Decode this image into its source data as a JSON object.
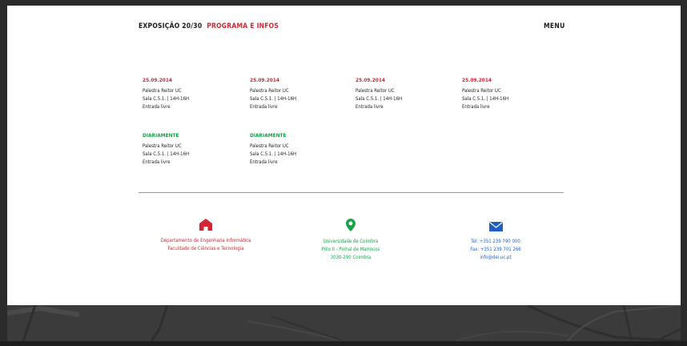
{
  "header": {
    "title": "EXPOSIÇÃO 20/30",
    "subtitle": "PROGRAMA E INFOS",
    "menu_label": "MENU"
  },
  "events": [
    {
      "date": "25.09.2014",
      "line1": "Palestra Reitor UC",
      "line2": "Sala C.5.1. | 14H-16H",
      "line3": "Entrada livre"
    },
    {
      "date": "25.09.2014",
      "line1": "Palestra Reitor UC",
      "line2": "Sala C.5.1. | 14H-16H",
      "line3": "Entrada livre"
    },
    {
      "date": "25.09.2014",
      "line1": "Palestra Reitor UC",
      "line2": "Sala C.5.1. | 14H-16H",
      "line3": "Entrada livre"
    },
    {
      "date": "25.09.2014",
      "line1": "Palestra Reitor UC",
      "line2": "Sala C.5.1. | 14H-16H",
      "line3": "Entrada livre"
    },
    {
      "date": "DIARIAMENTE",
      "line1": "Palestra Reitor UC",
      "line2": "Sala C.5.1. | 14H-16H",
      "line3": "Entrada livre"
    },
    {
      "date": "DIARIAMENTE",
      "line1": "Palestra Reitor UC",
      "line2": "Sala C.5.1. | 14H-16H",
      "line3": "Entrada livre"
    }
  ],
  "contacts": {
    "department": {
      "icon": "home-icon",
      "line1": "Departamento de Engenharia Informática",
      "line2": "Faculdade de Ciências e Tecnologia"
    },
    "location": {
      "icon": "location-pin-icon",
      "line1": "Universidade de Coimbra",
      "line2": "Pólo II - Pinhal de Marrocos",
      "line3": "3030-290 Coimbra"
    },
    "contact": {
      "icon": "envelope-icon",
      "tel": "Tel: +351 239 790 000",
      "fax": "Fax: +351 239 701 266",
      "email": "info@dei.uc.pt"
    }
  },
  "colors": {
    "accent_red": "#d32630",
    "accent_green": "#17a34a",
    "accent_blue": "#1f5fbf",
    "text_dark": "#1a1a1a"
  }
}
